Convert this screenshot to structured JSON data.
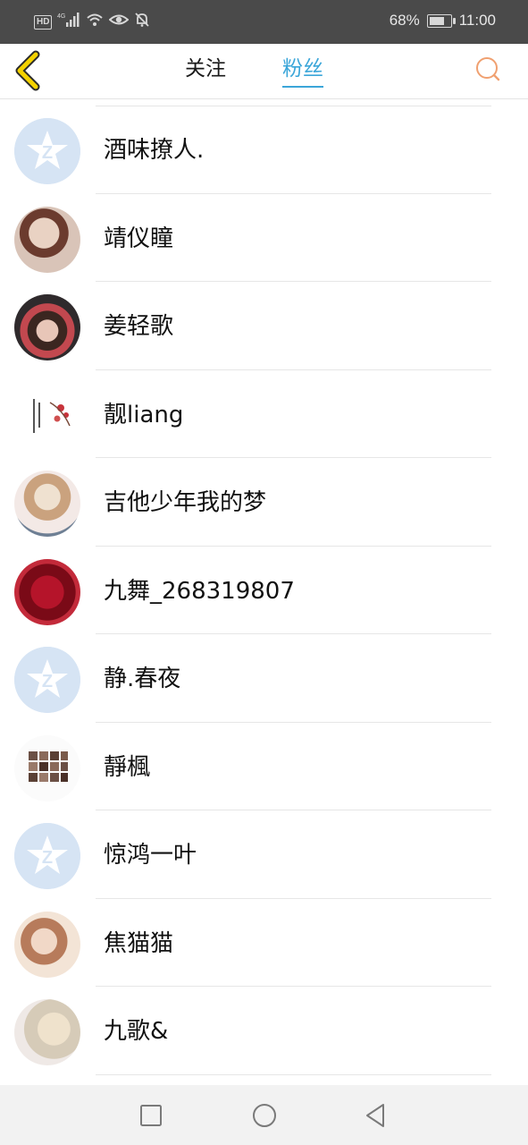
{
  "status_bar": {
    "hd": "HD",
    "network": "4G",
    "battery": "68%",
    "battery_level": 0.68,
    "time": "11:00",
    "icons": [
      "signal-icon",
      "wifi-icon",
      "eye-icon",
      "mute-bell-icon",
      "battery-icon"
    ]
  },
  "header": {
    "tabs": [
      {
        "label": "关注",
        "active": false
      },
      {
        "label": "粉丝",
        "active": true
      }
    ],
    "accent_color": "#3ba6d9",
    "back_icon": "chevron-left-icon",
    "back_icon_color": "#f4d200",
    "search_icon": "search-icon",
    "search_icon_color": "#f0a070"
  },
  "fans": [
    {
      "name": "酒味撩人.",
      "avatar": "default-avatar"
    },
    {
      "name": "靖仪瞳",
      "avatar": "photo"
    },
    {
      "name": "姜轻歌",
      "avatar": "photo"
    },
    {
      "name": "靓liang",
      "avatar": "photo"
    },
    {
      "name": "吉他少年我的梦",
      "avatar": "photo"
    },
    {
      "name": "九舞_268319807",
      "avatar": "photo"
    },
    {
      "name": "静.春夜",
      "avatar": "default-avatar"
    },
    {
      "name": "靜楓",
      "avatar": "photo"
    },
    {
      "name": "惊鸿一叶",
      "avatar": "default-avatar"
    },
    {
      "name": "焦猫猫",
      "avatar": "photo"
    },
    {
      "name": "九歌&",
      "avatar": "photo"
    }
  ],
  "nav_bar": {
    "icons": [
      "recent-apps-icon",
      "home-icon",
      "back-triangle-icon"
    ]
  }
}
